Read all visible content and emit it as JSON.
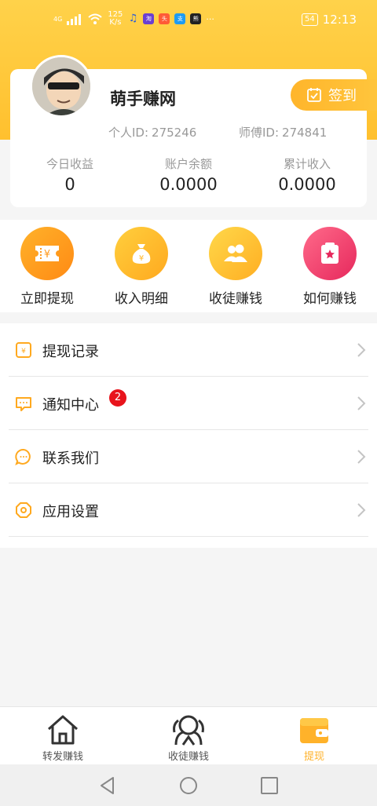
{
  "status_bar": {
    "signal": "4G",
    "net_speed": "125\nK/s",
    "battery": "54",
    "time": "12:13",
    "more": "···"
  },
  "profile": {
    "name": "萌手赚网",
    "checkin_label": "签到",
    "personal_id_label": "个人ID:",
    "personal_id": "275246",
    "mentor_id_label": "师傅ID:",
    "mentor_id": "274841"
  },
  "stats": [
    {
      "label": "今日收益",
      "value": "0"
    },
    {
      "label": "账户余额",
      "value": "0.0000"
    },
    {
      "label": "累计收入",
      "value": "0.0000"
    }
  ],
  "quick_actions": [
    {
      "label": "立即提现",
      "icon": "ticket-yen-icon",
      "color": "#ff9a1f"
    },
    {
      "label": "收入明细",
      "icon": "money-bag-icon",
      "color": "#ffb72b"
    },
    {
      "label": "收徒赚钱",
      "icon": "users-icon",
      "color": "#ffc030"
    },
    {
      "label": "如何赚钱",
      "icon": "star-box-icon",
      "color": "#f2406a"
    }
  ],
  "menu": [
    {
      "label": "提现记录",
      "icon": "yen-square-icon"
    },
    {
      "label": "通知中心",
      "icon": "message-icon",
      "badge": "2"
    },
    {
      "label": "联系我们",
      "icon": "chat-bubble-icon"
    },
    {
      "label": "应用设置",
      "icon": "settings-octagon-icon"
    }
  ],
  "tabs": [
    {
      "label": "转发赚钱",
      "icon": "home-icon",
      "active": false
    },
    {
      "label": "收徒赚钱",
      "icon": "apprentice-icon",
      "active": false
    },
    {
      "label": "提现",
      "icon": "wallet-icon",
      "active": true
    }
  ],
  "colors": {
    "brand": "#ffc02e",
    "accent": "#ffb22a",
    "badge": "#e8141c"
  }
}
